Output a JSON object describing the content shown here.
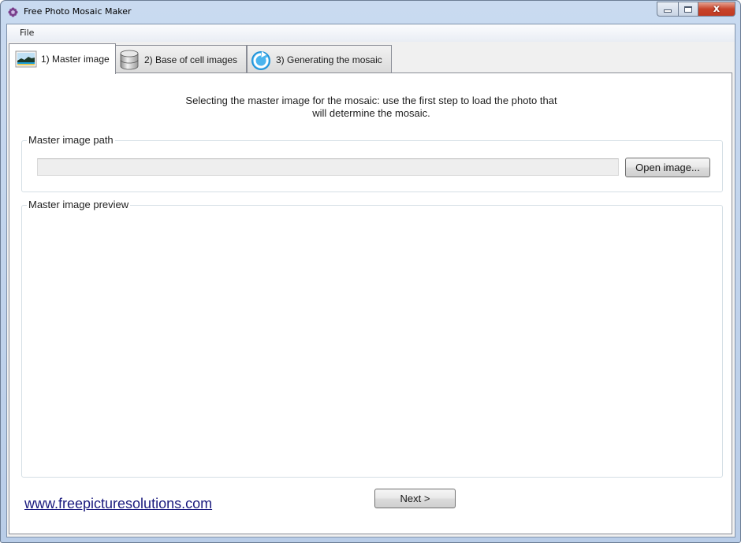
{
  "window": {
    "title": "Free Photo Mosaic Maker",
    "controls": {
      "minimize_label": "",
      "maximize_label": "",
      "close_label": "x"
    }
  },
  "menubar": {
    "items": [
      {
        "label": "File"
      }
    ]
  },
  "tabs": [
    {
      "label": "1) Master image",
      "icon": "landscape-picture-icon",
      "active": true
    },
    {
      "label": "2) Base of cell images",
      "icon": "database-icon",
      "active": false
    },
    {
      "label": "3) Generating the mosaic",
      "icon": "refresh-arrow-icon",
      "active": false
    }
  ],
  "master_tab": {
    "intro_line1": "Selecting the master image for the mosaic: use the first step to load the photo that",
    "intro_line2": "will determine the mosaic.",
    "path_group": {
      "legend": "Master image path",
      "path_value": "",
      "open_button": "Open image..."
    },
    "preview_group": {
      "legend": "Master image preview"
    },
    "website_link": "www.freepicturesolutions.com",
    "next_button": "Next >"
  },
  "colors": {
    "link": "#1a1a7e",
    "close_button": "#c7432a",
    "window_frame": "#c9daf0"
  }
}
